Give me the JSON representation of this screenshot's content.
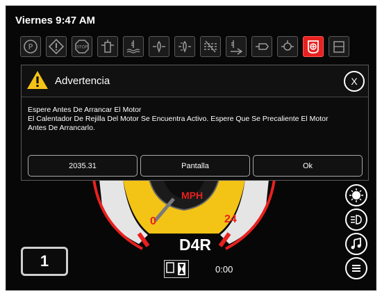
{
  "status_bar": {
    "datetime": "Viernes 9:47 AM"
  },
  "indicators": [
    {
      "icon": "parking-brake-icon",
      "active": false
    },
    {
      "icon": "warning-diamond-icon",
      "active": false
    },
    {
      "icon": "stop-icon",
      "active": false
    },
    {
      "icon": "fuel-filter-icon",
      "active": false
    },
    {
      "icon": "coolant-temp-icon",
      "active": false
    },
    {
      "icon": "hydraulic-filter-icon",
      "active": false
    },
    {
      "icon": "hydraulic-temp-icon",
      "active": false
    },
    {
      "icon": "air-filter-icon",
      "active": false
    },
    {
      "icon": "transmission-temp-icon",
      "active": false
    },
    {
      "icon": "engine-oil-icon",
      "active": false
    },
    {
      "icon": "glow-plug-icon",
      "active": false
    },
    {
      "icon": "grid-heater-icon",
      "active": true
    },
    {
      "icon": "def-level-icon",
      "active": false
    }
  ],
  "dialog": {
    "title": "Advertencia",
    "message_lines": [
      "Espere Antes De Arrancar El Motor",
      "El Calentador De Rejilla Del Motor Se Encuentra Activo. Espere Que Se Precaliente El Motor",
      "Antes De Arrancarlo."
    ],
    "buttons": {
      "code": "2035.31",
      "screen": "Pantalla",
      "ok": "Ok"
    }
  },
  "gauge": {
    "unit": "MPH",
    "min_label": "0",
    "max_label": "24",
    "gear": "D4R",
    "timer": "0:00"
  },
  "gear_selector": {
    "value": "1"
  },
  "side_buttons": [
    "brightness-icon",
    "headlight-icon",
    "music-note-icon",
    "menu-icon"
  ]
}
